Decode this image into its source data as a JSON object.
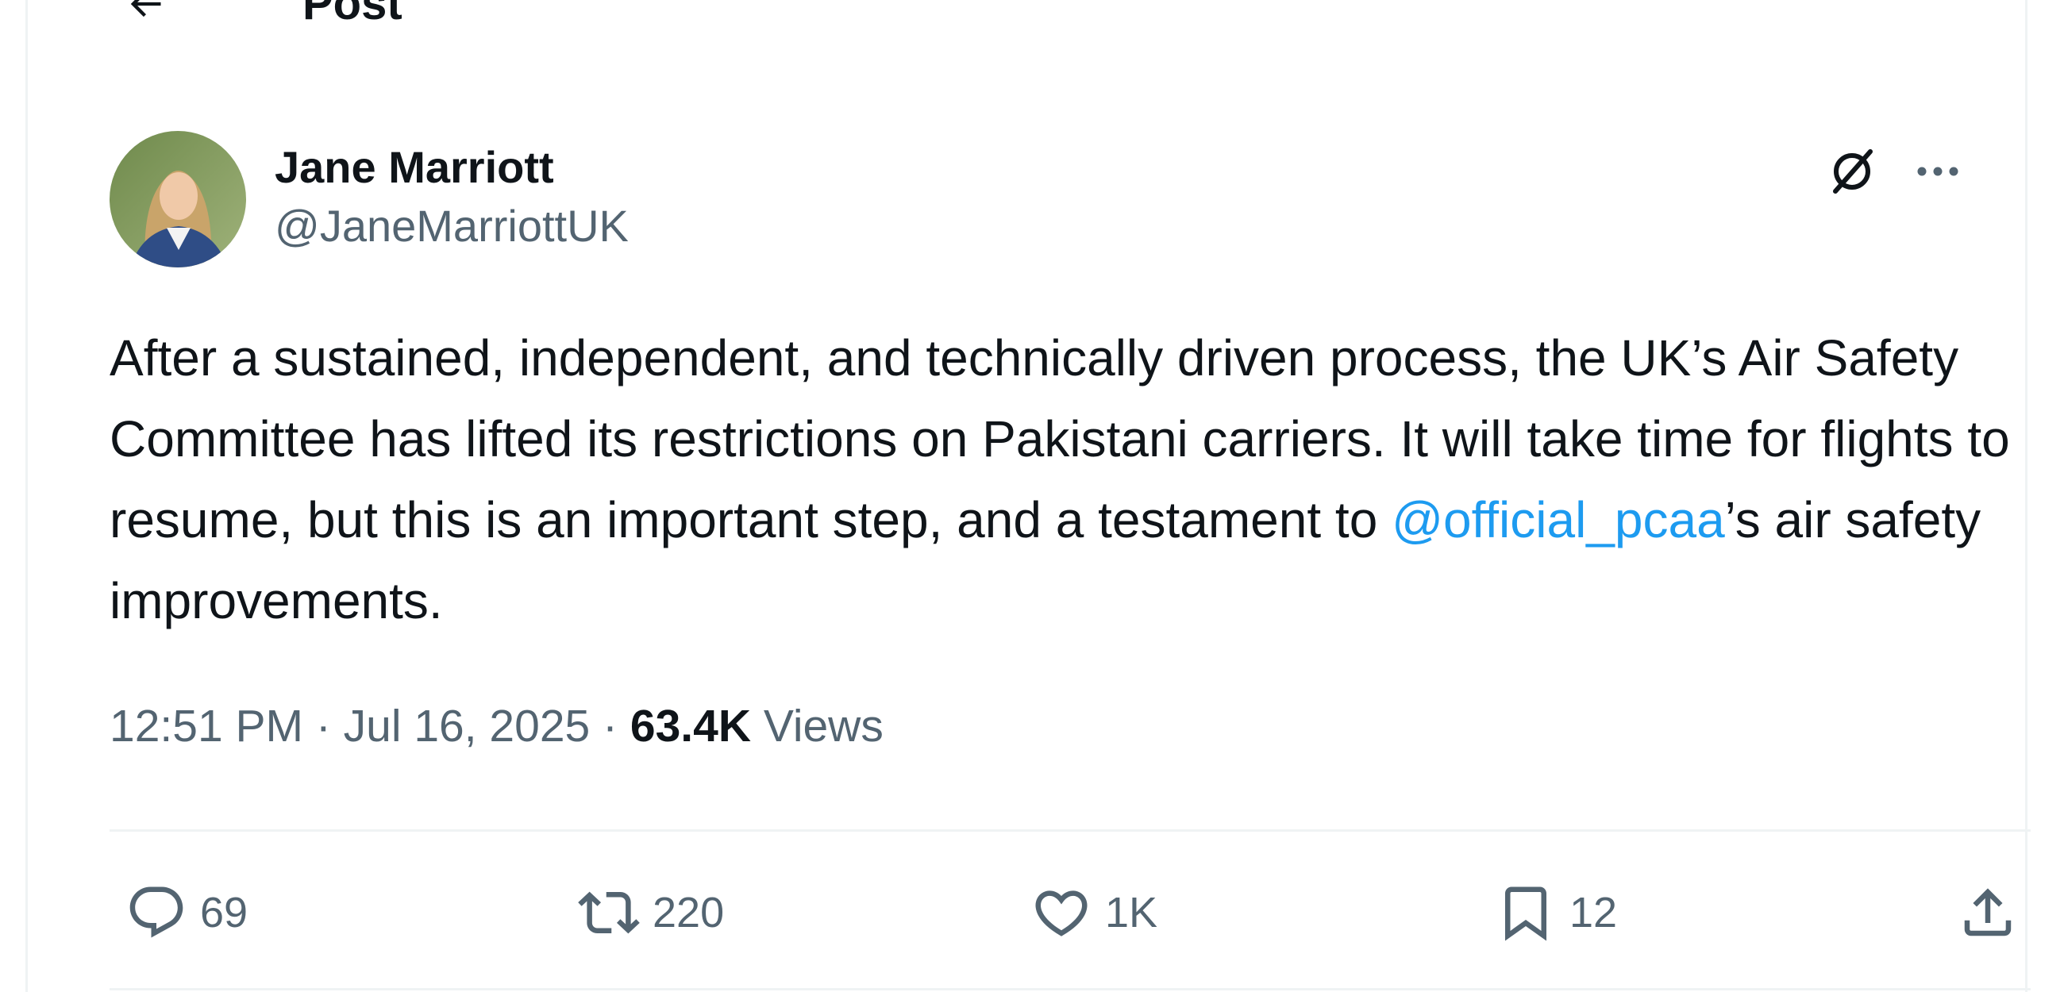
{
  "header": {
    "title": "Post"
  },
  "author": {
    "display_name": "Jane Marriott",
    "handle": "@JaneMarriottUK"
  },
  "tweet": {
    "text_before": "After a sustained, independent, and technically driven process, the UK’s Air Safety Committee has lifted its restrictions on Pakistani carriers. It will take time for flights to resume, but this is an important step, and a testament to ",
    "mention": "@official_pcaa",
    "text_after": "’s air safety improvements.",
    "mention_color": "#1d9bf0"
  },
  "meta": {
    "time": "12:51 PM",
    "separator": " · ",
    "date": "Jul 16, 2025",
    "views_count": "63.4K",
    "views_label": "Views"
  },
  "actions": {
    "replies": "69",
    "reposts": "220",
    "likes": "1K",
    "bookmarks": "12"
  },
  "icons": {
    "back": "back-arrow-icon",
    "grok": "grok-icon",
    "more": "more-options-icon",
    "reply": "reply-icon",
    "repost": "repost-icon",
    "like": "heart-icon",
    "bookmark": "bookmark-icon",
    "share": "share-icon"
  },
  "colors": {
    "text_primary": "#0f1419",
    "text_secondary": "#536471",
    "accent": "#1d9bf0",
    "divider": "#eff3f4"
  }
}
